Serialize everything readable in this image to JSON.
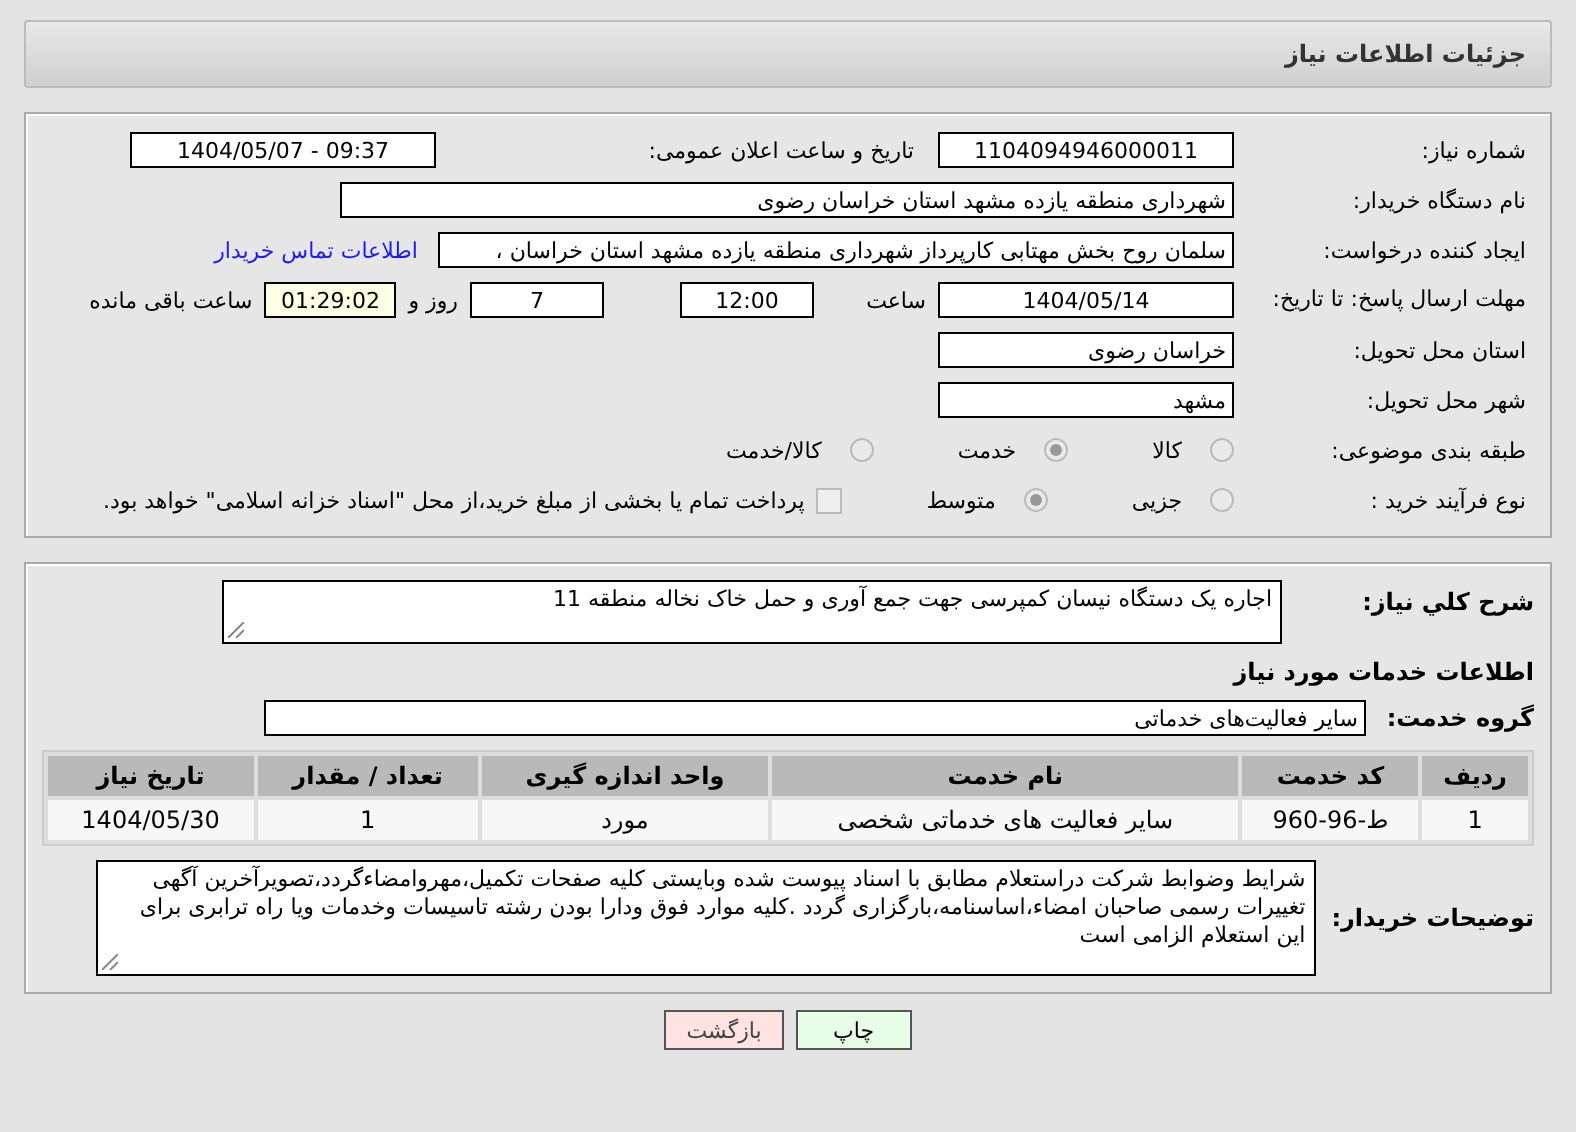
{
  "header": {
    "title": "جزئیات اطلاعات نیاز"
  },
  "need_number": {
    "label": "شماره نیاز:",
    "value": "1104094946000011"
  },
  "announce": {
    "label": "تاریخ و ساعت اعلان عمومی:",
    "value": "1404/05/07 - 09:37"
  },
  "buyer": {
    "label": "نام دستگاه خریدار:",
    "value": "شهرداری منطقه یازده مشهد استان خراسان رضوی"
  },
  "creator": {
    "label": "ایجاد کننده درخواست:",
    "value": "سلمان روح بخش مهتابی کارپرداز شهرداری منطقه یازده مشهد استان خراسان ،",
    "link": "اطلاعات تماس خریدار"
  },
  "deadline": {
    "label": "مهلت ارسال پاسخ: تا تاریخ:",
    "date": "1404/05/14",
    "time_label": "ساعت",
    "time": "12:00",
    "days": "7",
    "days_label": "روز و",
    "remaining": "01:29:02",
    "remaining_label": "ساعت باقی مانده"
  },
  "province": {
    "label": "استان محل تحویل:",
    "value": "خراسان رضوی"
  },
  "city": {
    "label": "شهر محل تحویل:",
    "value": "مشهد"
  },
  "classification": {
    "label": "طبقه بندی موضوعی:",
    "options": [
      {
        "label": "کالا",
        "selected": false
      },
      {
        "label": "خدمت",
        "selected": true
      },
      {
        "label": "کالا/خدمت",
        "selected": false
      }
    ]
  },
  "process": {
    "label": "نوع فرآیند خرید :",
    "options": [
      {
        "label": "جزیی",
        "selected": false
      },
      {
        "label": "متوسط",
        "selected": true
      }
    ],
    "payment": {
      "label": "پرداخت تمام یا بخشی از مبلغ خرید،از محل \"اسناد خزانه اسلامی\" خواهد بود.",
      "checked": false
    }
  },
  "description": {
    "label": "شرح کلي نياز:",
    "value": "اجاره یک دستگاه نیسان کمپرسی جهت جمع آوری و حمل خاک نخاله منطقه 11"
  },
  "services_title": "اطلاعات خدمات مورد نیاز",
  "service_group": {
    "label": "گروه خدمت:",
    "value": "سایر فعالیت‌های خدماتی"
  },
  "table": {
    "columns": [
      "ردیف",
      "کد خدمت",
      "نام خدمت",
      "واحد اندازه گیری",
      "تعداد / مقدار",
      "تاریخ نیاز"
    ],
    "rows": [
      [
        "1",
        "ط-96-960",
        "سایر فعالیت های خدماتی شخصی",
        "مورد",
        "1",
        "1404/05/30"
      ]
    ]
  },
  "buyer_notes": {
    "label": "توضیحات خریدار:",
    "value": "شرایط وضوابط شرکت دراستعلام مطابق با اسناد پیوست شده وبایستی کلیه صفحات تکمیل،مهروامضاءگردد،تصویرآخرین آگهی تغییرات رسمی صاحبان امضاء،اساسنامه،بارگزاری گردد .کلیه موارد فوق ودارا بودن رشته تاسیسات وخدمات ویا راه ترابری برای این استعلام الزامی است"
  },
  "buttons": [
    {
      "label": "چاپ",
      "kind": "print"
    },
    {
      "label": "بازگشت",
      "kind": "back"
    }
  ]
}
